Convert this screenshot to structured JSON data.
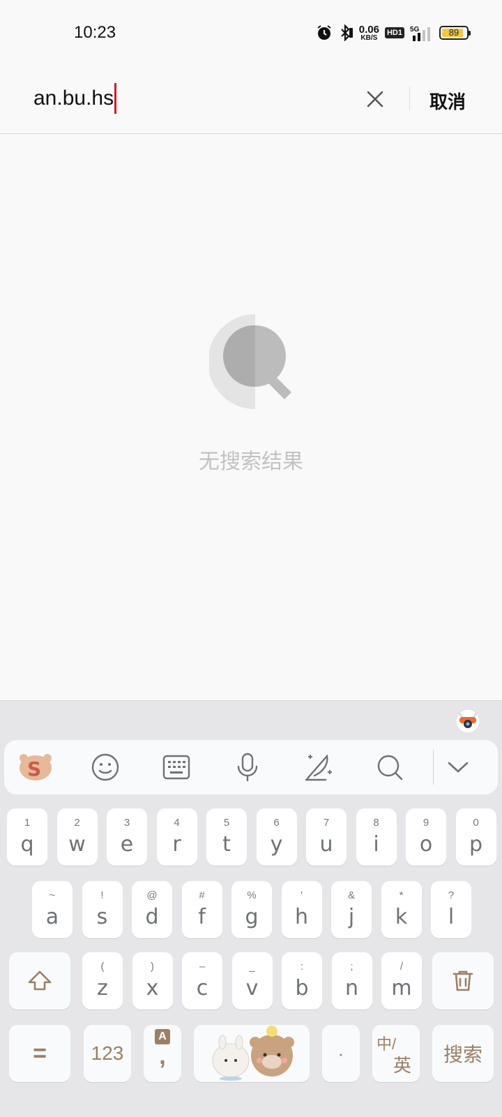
{
  "status_bar": {
    "time": "10:23",
    "net_speed_value": "0.06",
    "net_speed_unit": "KB/S",
    "hd_badge": "HD1",
    "network": "5G",
    "battery": "89",
    "battery_level": 0.89
  },
  "search": {
    "query": "an.bu.hs",
    "cancel_label": "取消"
  },
  "empty_state": {
    "message": "无搜索结果"
  },
  "keyboard": {
    "row1": [
      {
        "hint": "1",
        "key": "q"
      },
      {
        "hint": "2",
        "key": "w"
      },
      {
        "hint": "3",
        "key": "e"
      },
      {
        "hint": "4",
        "key": "r"
      },
      {
        "hint": "5",
        "key": "t"
      },
      {
        "hint": "6",
        "key": "y"
      },
      {
        "hint": "7",
        "key": "u"
      },
      {
        "hint": "8",
        "key": "i"
      },
      {
        "hint": "9",
        "key": "o"
      },
      {
        "hint": "0",
        "key": "p"
      }
    ],
    "row2": [
      {
        "hint": "~",
        "key": "a"
      },
      {
        "hint": "!",
        "key": "s"
      },
      {
        "hint": "@",
        "key": "d"
      },
      {
        "hint": "#",
        "key": "f"
      },
      {
        "hint": "%",
        "key": "g"
      },
      {
        "hint": "'",
        "key": "h"
      },
      {
        "hint": "&",
        "key": "j"
      },
      {
        "hint": "*",
        "key": "k"
      },
      {
        "hint": "?",
        "key": "l"
      }
    ],
    "row3": [
      {
        "hint": "(",
        "key": "z"
      },
      {
        "hint": ")",
        "key": "x"
      },
      {
        "hint": "–",
        "key": "c"
      },
      {
        "hint": "_",
        "key": "v"
      },
      {
        "hint": ":",
        "key": "b"
      },
      {
        "hint": ";",
        "key": "n"
      },
      {
        "hint": "/",
        "key": "m"
      }
    ],
    "bottom": {
      "symbols_label": "=",
      "numbers_label": "123",
      "punct_hint": "A",
      "punct_main": ",",
      "period_label": "·",
      "lang_top": "中/",
      "lang_bottom": "英",
      "search_label": "搜索"
    }
  },
  "colors": {
    "caret": "#c81f26",
    "key_text": "#6d7178",
    "func_text": "#9b8066",
    "keyboard_bg": "#e6e6e8"
  }
}
